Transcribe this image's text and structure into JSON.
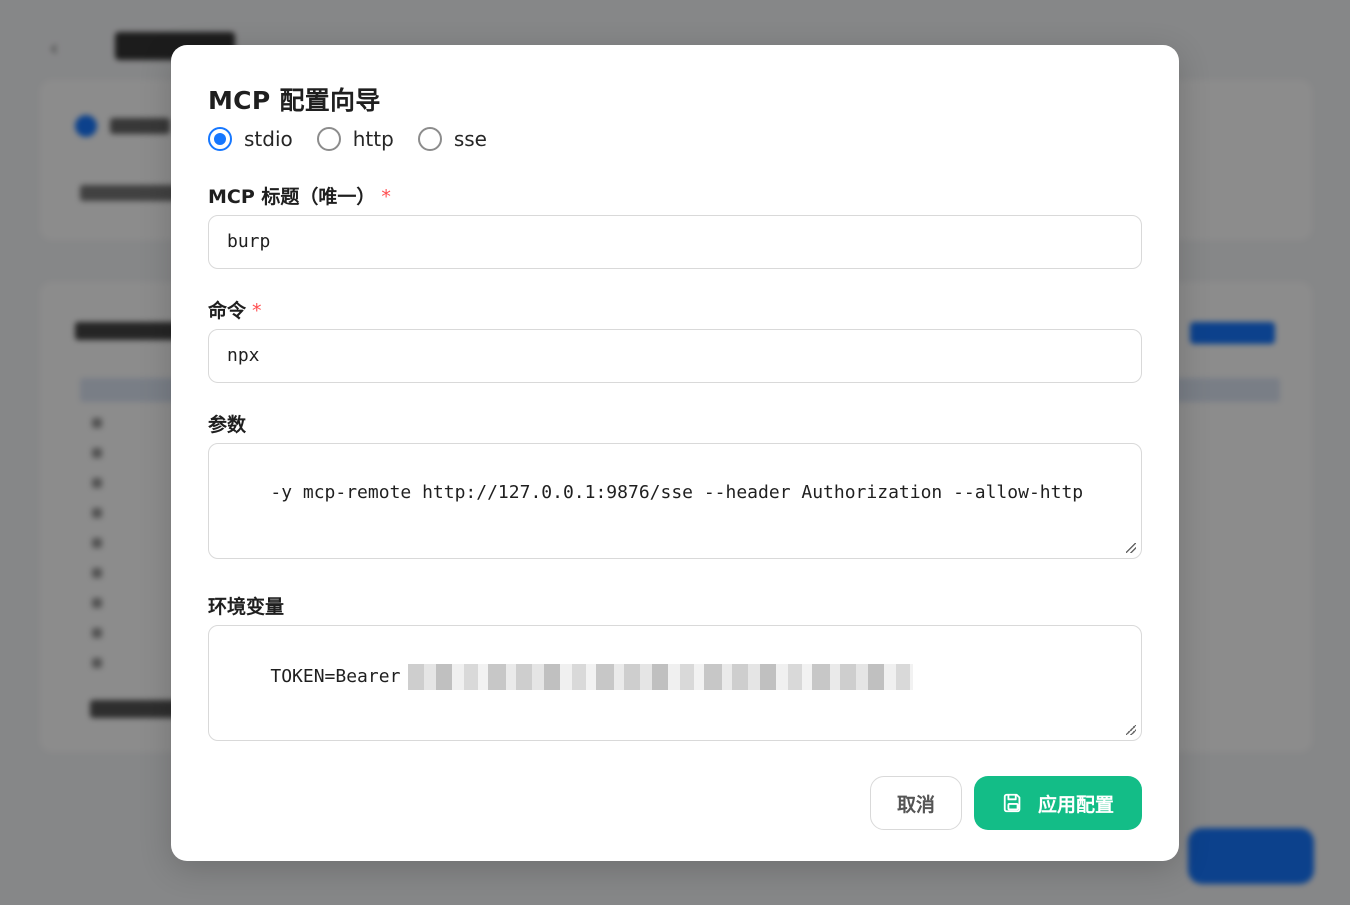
{
  "dialog": {
    "title": "MCP 配置向导",
    "transport_options": [
      {
        "label": "stdio",
        "selected": true
      },
      {
        "label": "http",
        "selected": false
      },
      {
        "label": "sse",
        "selected": false
      }
    ],
    "fields": {
      "title": {
        "label": "MCP 标题（唯一）",
        "required_mark": "*",
        "value": "burp"
      },
      "command": {
        "label": "命令",
        "required_mark": "*",
        "value": "npx"
      },
      "args": {
        "label": "参数",
        "value": "-y mcp-remote http://127.0.0.1:9876/sse --header Authorization --allow-http"
      },
      "env": {
        "label": "环境变量",
        "value": "TOKEN=Bearer"
      }
    },
    "buttons": {
      "cancel": "取消",
      "apply": "应用配置"
    }
  },
  "colors": {
    "accent": "#1677ff",
    "primary_button": "#13bd87",
    "required": "#ff4d4f",
    "overlay": "rgba(0,0,0,0.45)"
  },
  "icons": {
    "apply_button": "save-icon"
  }
}
